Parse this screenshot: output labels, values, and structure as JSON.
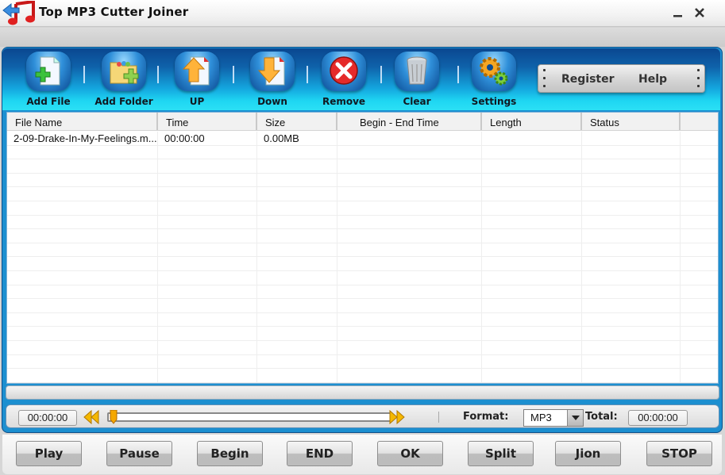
{
  "window": {
    "title": "Top MP3 Cutter Joiner",
    "minimize_label": "minimize",
    "close_label": "close"
  },
  "toolbar": {
    "buttons": [
      {
        "id": "add-file",
        "label": "Add File",
        "icon": "add-file-icon"
      },
      {
        "id": "add-folder",
        "label": "Add Folder",
        "icon": "add-folder-icon"
      },
      {
        "id": "up",
        "label": "UP",
        "icon": "move-up-icon"
      },
      {
        "id": "down",
        "label": "Down",
        "icon": "move-down-icon"
      },
      {
        "id": "remove",
        "label": "Remove",
        "icon": "remove-icon"
      },
      {
        "id": "clear",
        "label": "Clear",
        "icon": "trash-icon"
      },
      {
        "id": "settings",
        "label": "Settings",
        "icon": "gears-icon"
      }
    ],
    "register_label": "Register",
    "help_label": "Help"
  },
  "table": {
    "columns": [
      "File Name",
      "Time",
      "Size",
      "Begin - End Time",
      "Length",
      "Status",
      ""
    ],
    "rows": [
      [
        "2-09-Drake-In-My-Feelings.m...",
        "00:00:00",
        "0.00MB",
        "",
        "",
        "",
        ""
      ]
    ]
  },
  "player": {
    "current_time": "00:00:00",
    "seek_position": 0,
    "format_label": "Format:",
    "format_value": "MP3",
    "total_label": "Total:",
    "total_time": "00:00:00"
  },
  "actions": [
    "Play",
    "Pause",
    "Begin",
    "END",
    "OK",
    "Split",
    "Jion",
    "STOP"
  ],
  "colors": {
    "frame_blue": "#1c8fd0",
    "toolbar_dark": "#0a4790",
    "toolbar_light": "#2be0f5",
    "seek_thumb": "#f5a800"
  }
}
